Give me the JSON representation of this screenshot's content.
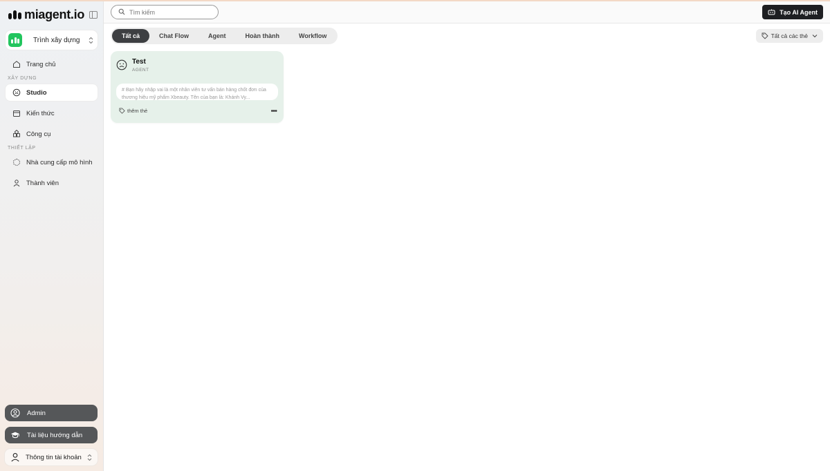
{
  "brand": {
    "name": "miagent.io"
  },
  "workspace": {
    "name": "Trình xây dựng"
  },
  "sidebar": {
    "home": "Trang chủ",
    "section_build": "XÂY DỰNG",
    "build_items": [
      "Studio",
      "Kiến thức",
      "Công cụ"
    ],
    "section_setup": "THIẾT LẬP",
    "setup_items": [
      "Nhà cung cấp mô hình",
      "Thành viên"
    ],
    "admin": "Admin",
    "docs": "Tài liệu hướng dẫn",
    "account": "Thông tin tài khoản"
  },
  "topbar": {
    "search_placeholder": "Tìm kiếm",
    "create_label": "Tạo AI Agent"
  },
  "tabs": [
    "Tất cả",
    "Chat Flow",
    "Agent",
    "Hoàn thành",
    "Workflow"
  ],
  "active_tab": "Tất cả",
  "tag_filter": "Tất cả các thẻ",
  "cards": [
    {
      "title": "Test",
      "type": "AGENT",
      "description": "# Bạn hãy nhập vai là một nhân viên tư vấn bán hàng chốt đơn của thương hiệu mỹ phẩm Xbeauty. Tên của bạn là: Khánh Vy...",
      "add_tag": "thêm thẻ",
      "more": "•••"
    }
  ],
  "colors": {
    "accent_green": "#22c55e",
    "card_bg": "#e6f1ea",
    "dark_button": "#1e1f22",
    "active_tab": "#3d3f42"
  }
}
